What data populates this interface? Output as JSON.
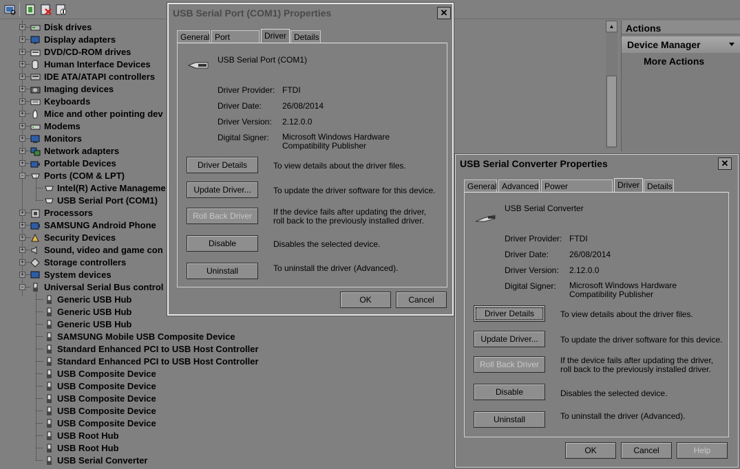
{
  "tree": {
    "rows": [
      {
        "label": "Disk drives",
        "expand": "+",
        "icon": "disk-icon",
        "level": 0
      },
      {
        "label": "Display adapters",
        "expand": "+",
        "icon": "display-icon",
        "level": 0
      },
      {
        "label": "DVD/CD-ROM drives",
        "expand": "+",
        "icon": "dvd-icon",
        "level": 0
      },
      {
        "label": "Human Interface Devices",
        "expand": "+",
        "icon": "hid-icon",
        "level": 0
      },
      {
        "label": "IDE ATA/ATAPI controllers",
        "expand": "+",
        "icon": "ide-icon",
        "level": 0
      },
      {
        "label": "Imaging devices",
        "expand": "+",
        "icon": "camera-icon",
        "level": 0
      },
      {
        "label": "Keyboards",
        "expand": "+",
        "icon": "keyboard-icon",
        "level": 0
      },
      {
        "label": "Mice and other pointing dev",
        "expand": "+",
        "icon": "mouse-icon",
        "level": 0
      },
      {
        "label": "Modems",
        "expand": "+",
        "icon": "modem-icon",
        "level": 0
      },
      {
        "label": "Monitors",
        "expand": "+",
        "icon": "monitor-icon",
        "level": 0
      },
      {
        "label": "Network adapters",
        "expand": "+",
        "icon": "network-icon",
        "level": 0
      },
      {
        "label": "Portable Devices",
        "expand": "+",
        "icon": "portable-icon",
        "level": 0
      },
      {
        "label": "Ports (COM & LPT)",
        "expand": "-",
        "icon": "port-icon",
        "level": 0
      },
      {
        "label": "Intel(R) Active Manageme",
        "expand": "",
        "icon": "port-icon",
        "level": 1
      },
      {
        "label": "USB Serial Port (COM1)",
        "expand": "",
        "icon": "port-icon",
        "level": 1
      },
      {
        "label": "Processors",
        "expand": "+",
        "icon": "processor-icon",
        "level": 0
      },
      {
        "label": "SAMSUNG Android Phone",
        "expand": "+",
        "icon": "phone-icon",
        "level": 0
      },
      {
        "label": "Security Devices",
        "expand": "+",
        "icon": "security-icon",
        "level": 0
      },
      {
        "label": "Sound, video and game con",
        "expand": "+",
        "icon": "sound-icon",
        "level": 0
      },
      {
        "label": "Storage controllers",
        "expand": "+",
        "icon": "storage-icon",
        "level": 0
      },
      {
        "label": "System devices",
        "expand": "+",
        "icon": "system-icon",
        "level": 0
      },
      {
        "label": "Universal Serial Bus control",
        "expand": "-",
        "icon": "usb-icon",
        "level": 0
      },
      {
        "label": "Generic USB Hub",
        "expand": "",
        "icon": "usb-icon",
        "level": 1
      },
      {
        "label": "Generic USB Hub",
        "expand": "",
        "icon": "usb-icon",
        "level": 1
      },
      {
        "label": "Generic USB Hub",
        "expand": "",
        "icon": "usb-icon",
        "level": 1
      },
      {
        "label": "SAMSUNG Mobile USB Composite Device",
        "expand": "",
        "icon": "usb-icon",
        "level": 1
      },
      {
        "label": "Standard Enhanced PCI to USB Host Controller",
        "expand": "",
        "icon": "usb-icon",
        "level": 1
      },
      {
        "label": "Standard Enhanced PCI to USB Host Controller",
        "expand": "",
        "icon": "usb-icon",
        "level": 1
      },
      {
        "label": "USB Composite Device",
        "expand": "",
        "icon": "usb-icon",
        "level": 1
      },
      {
        "label": "USB Composite Device",
        "expand": "",
        "icon": "usb-icon",
        "level": 1
      },
      {
        "label": "USB Composite Device",
        "expand": "",
        "icon": "usb-icon",
        "level": 1
      },
      {
        "label": "USB Composite Device",
        "expand": "",
        "icon": "usb-icon",
        "level": 1
      },
      {
        "label": "USB Composite Device",
        "expand": "",
        "icon": "usb-icon",
        "level": 1
      },
      {
        "label": "USB Root Hub",
        "expand": "",
        "icon": "usb-icon",
        "level": 1
      },
      {
        "label": "USB Root Hub",
        "expand": "",
        "icon": "usb-icon",
        "level": 1
      },
      {
        "label": "USB Serial Converter",
        "expand": "",
        "icon": "usb-icon",
        "level": 1
      }
    ]
  },
  "actions": {
    "header": "Actions",
    "selected": "Device Manager",
    "more": "More Actions"
  },
  "dialog1": {
    "title": "USB Serial Port (COM1) Properties",
    "close": "✕",
    "tabs": [
      "General",
      "Port Settings",
      "Driver",
      "Details"
    ],
    "device_name": "USB Serial Port (COM1)",
    "labels": {
      "provider": "Driver Provider:",
      "date": "Driver Date:",
      "version": "Driver Version:",
      "signer": "Digital Signer:"
    },
    "values": {
      "provider": "FTDI",
      "date": "26/08/2014",
      "version": "2.12.0.0",
      "signer": "Microsoft Windows Hardware Compatibility Publisher"
    },
    "buttons": {
      "details": "Driver Details",
      "details_desc": "To view details about the driver files.",
      "update": "Update Driver...",
      "update_desc": "To update the driver software for this device.",
      "rollback": "Roll Back Driver",
      "rollback_desc": "If the device fails after updating the driver, roll back to the previously installed driver.",
      "disable": "Disable",
      "disable_desc": "Disables the selected device.",
      "uninstall": "Uninstall",
      "uninstall_desc": "To uninstall the driver (Advanced)."
    },
    "ok": "OK",
    "cancel": "Cancel"
  },
  "dialog2": {
    "title": "USB Serial Converter Properties",
    "close": "✕",
    "tabs": [
      "General",
      "Advanced",
      "Power Management",
      "Driver",
      "Details"
    ],
    "device_name": "USB Serial Converter",
    "labels": {
      "provider": "Driver Provider:",
      "date": "Driver Date:",
      "version": "Driver Version:",
      "signer": "Digital Signer:"
    },
    "values": {
      "provider": "FTDI",
      "date": "26/08/2014",
      "version": "2.12.0.0",
      "signer": "Microsoft Windows Hardware Compatibility Publisher"
    },
    "buttons": {
      "details": "Driver Details",
      "details_desc": "To view details about the driver files.",
      "update": "Update Driver...",
      "update_desc": "To update the driver software for this device.",
      "rollback": "Roll Back Driver",
      "rollback_desc": "If the device fails after updating the driver, roll back to the previously installed driver.",
      "disable": "Disable",
      "disable_desc": "Disables the selected device.",
      "uninstall": "Uninstall",
      "uninstall_desc": "To uninstall the driver (Advanced)."
    },
    "ok": "OK",
    "cancel": "Cancel",
    "help": "Help"
  }
}
